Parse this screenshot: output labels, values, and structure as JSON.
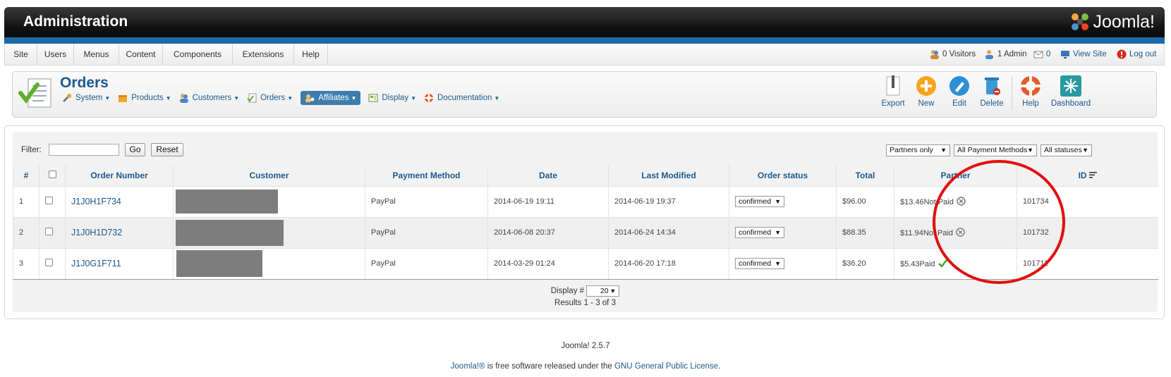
{
  "header": {
    "title": "Administration",
    "logo_text": "Joomla!"
  },
  "menu": {
    "items": [
      "Site",
      "Users",
      "Menus",
      "Content",
      "Components",
      "Extensions",
      "Help"
    ],
    "status": {
      "visitors": "0 Visitors",
      "admins": "1 Admin",
      "messages": "0",
      "view_site": "View Site",
      "logout": "Log out"
    }
  },
  "page": {
    "title": "Orders",
    "submenu": [
      {
        "label": "System",
        "icon": "tools-icon"
      },
      {
        "label": "Products",
        "icon": "box-icon"
      },
      {
        "label": "Customers",
        "icon": "customers-icon"
      },
      {
        "label": "Orders",
        "icon": "orders-icon"
      },
      {
        "label": "Affiliates",
        "icon": "affiliates-icon",
        "active": true
      },
      {
        "label": "Display",
        "icon": "display-icon"
      },
      {
        "label": "Documentation",
        "icon": "lifebuoy-icon"
      }
    ],
    "toolbar": {
      "export": "Export",
      "new": "New",
      "edit": "Edit",
      "delete": "Delete",
      "help": "Help",
      "dashboard": "Dashboard"
    }
  },
  "filter": {
    "label": "Filter:",
    "value": "",
    "go": "Go",
    "reset": "Reset",
    "partners": "Partners only",
    "payment_methods": "All Payment Methods",
    "statuses": "All statuses"
  },
  "table": {
    "columns": {
      "num": "#",
      "order_number": "Order Number",
      "customer": "Customer",
      "payment_method": "Payment Method",
      "date": "Date",
      "last_modified": "Last Modified",
      "order_status": "Order status",
      "total": "Total",
      "partner": "Partner",
      "id": "ID"
    },
    "rows": [
      {
        "num": "1",
        "order_number": "J1J0H1F734",
        "payment_method": "PayPal",
        "date": "2014-06-19 19:11",
        "last_modified": "2014-06-19 19:37",
        "status": "confirmed",
        "total": "$96.00",
        "partner_amount": "$13.46",
        "partner_status": "Not Paid",
        "id": "101734"
      },
      {
        "num": "2",
        "order_number": "J1J0H1D732",
        "payment_method": "PayPal",
        "date": "2014-06-08 20:37",
        "last_modified": "2014-06-24 14:34",
        "status": "confirmed",
        "total": "$88.35",
        "partner_amount": "$11.94",
        "partner_status": "Not Paid",
        "id": "101732"
      },
      {
        "num": "3",
        "order_number": "J1J0G1F711",
        "payment_method": "PayPal",
        "date": "2014-03-29 01:24",
        "last_modified": "2014-06-20 17:18",
        "status": "confirmed",
        "total": "$36.20",
        "partner_amount": "$5.43",
        "partner_status": "Paid",
        "id": "101711"
      }
    ]
  },
  "pagination": {
    "display_label": "Display #",
    "display_value": "20",
    "results": "Results 1 - 3 of 3"
  },
  "footer": {
    "version": "Joomla! 2.5.7",
    "joomla_link": "Joomla!®",
    "license_mid": " is free software released under the ",
    "license_link": "GNU General Public License",
    "license_end": "."
  },
  "colors": {
    "header_bar": "#1d6aa8",
    "link": "#1a5a8c",
    "annotation": "#e01010",
    "affiliates_active": "#3c7dad"
  }
}
